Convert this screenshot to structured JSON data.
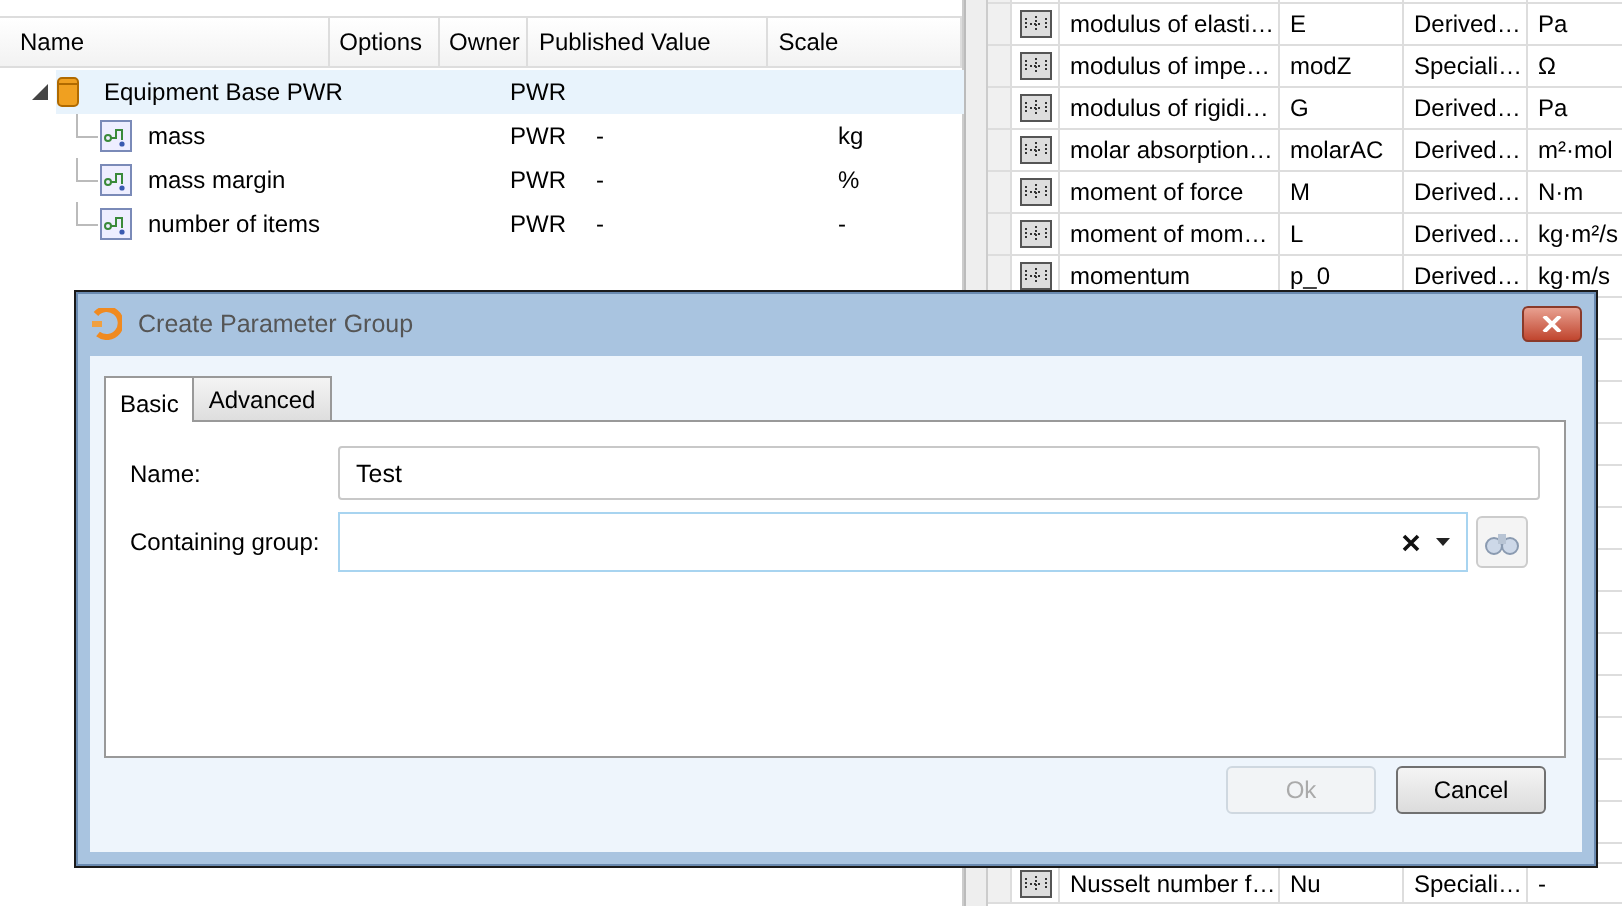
{
  "parameter_tree": {
    "columns": [
      "Name",
      "Options",
      "Owner",
      "Published Value",
      "Scale"
    ],
    "rows": [
      {
        "kind": "group",
        "name": "Equipment Base PWR",
        "owner": "PWR",
        "expanded": true,
        "selected": true,
        "children": [
          {
            "kind": "parameter",
            "name": "mass",
            "owner": "PWR",
            "published_value": "-",
            "scale": "kg",
            "selected": false
          },
          {
            "kind": "parameter",
            "name": "mass margin",
            "owner": "PWR",
            "published_value": "-",
            "scale": "%",
            "selected": false
          },
          {
            "kind": "parameter",
            "name": "number of items",
            "owner": "PWR",
            "published_value": "-",
            "scale": "-",
            "selected": false
          }
        ]
      }
    ]
  },
  "quantity_table": {
    "rows": [
      {
        "name": "modulus of elasti…",
        "symbol": "E",
        "type": "Derived…",
        "unit": "Pa"
      },
      {
        "name": "modulus of impe…",
        "symbol": "modZ",
        "type": "Speciali…",
        "unit": "Ω"
      },
      {
        "name": "modulus of rigidi…",
        "symbol": "G",
        "type": "Derived…",
        "unit": "Pa"
      },
      {
        "name": "molar absorption…",
        "symbol": "molarAC",
        "type": "Derived…",
        "unit": "m²·mol"
      },
      {
        "name": "moment of force",
        "symbol": "M",
        "type": "Derived…",
        "unit": "N·m"
      },
      {
        "name": "moment of mom…",
        "symbol": "L",
        "type": "Derived…",
        "unit": "kg·m²/s"
      },
      {
        "name": "momentum",
        "symbol": "p_0",
        "type": "Derived…",
        "unit": "kg·m/s"
      }
    ],
    "bottom_rows": [
      {
        "name": "Nusselt number f…",
        "symbol": "Nu",
        "type": "Speciali…",
        "unit": "-"
      }
    ]
  },
  "dialog": {
    "title": "Create Parameter Group",
    "tabs": [
      {
        "label": "Basic",
        "selected": true
      },
      {
        "label": "Advanced",
        "selected": false
      }
    ],
    "fields": [
      {
        "kind": "text",
        "label": "Name:",
        "value": "Test"
      },
      {
        "kind": "combo",
        "label": "Containing group:"
      }
    ],
    "buttons": [
      {
        "label": "Ok",
        "disabled": true
      },
      {
        "label": "Cancel",
        "disabled": false
      }
    ]
  }
}
